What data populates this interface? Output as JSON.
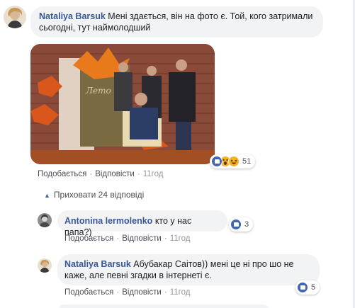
{
  "comment": {
    "author": "Nataliya Barsuk",
    "text": "Мені здається, він на фото є. Той, кого затримали сьогодні, тут наймолодший",
    "actions": {
      "like": "Подобається",
      "reply": "Відповісти",
      "time": "11год"
    },
    "reaction_count": "51",
    "reaction_icons": [
      "like-icon",
      "wow-icon",
      "haha-icon"
    ]
  },
  "toggle": {
    "arrow": "▲",
    "label": "Приховати 24 відповіді"
  },
  "replies": [
    {
      "author": "Antonina Iermolenko",
      "text": "кто у нас папа?)",
      "actions": {
        "like": "Подобається",
        "reply": "Відповісти",
        "time": "11год"
      },
      "reaction_count": "3"
    },
    {
      "author": "Nataliya Barsuk",
      "text": "Абубакар Саітов)) мені це ні про шо не каже, але певні згадки в інтернеті є.",
      "actions": {
        "like": "Подобається",
        "reply": "Відповісти",
        "time": "11год"
      },
      "reaction_count": "5"
    }
  ],
  "colors": {
    "link": "#385898",
    "bubble": "#f2f3f5",
    "meta": "#90949c",
    "like_blue": "#4267b2"
  }
}
